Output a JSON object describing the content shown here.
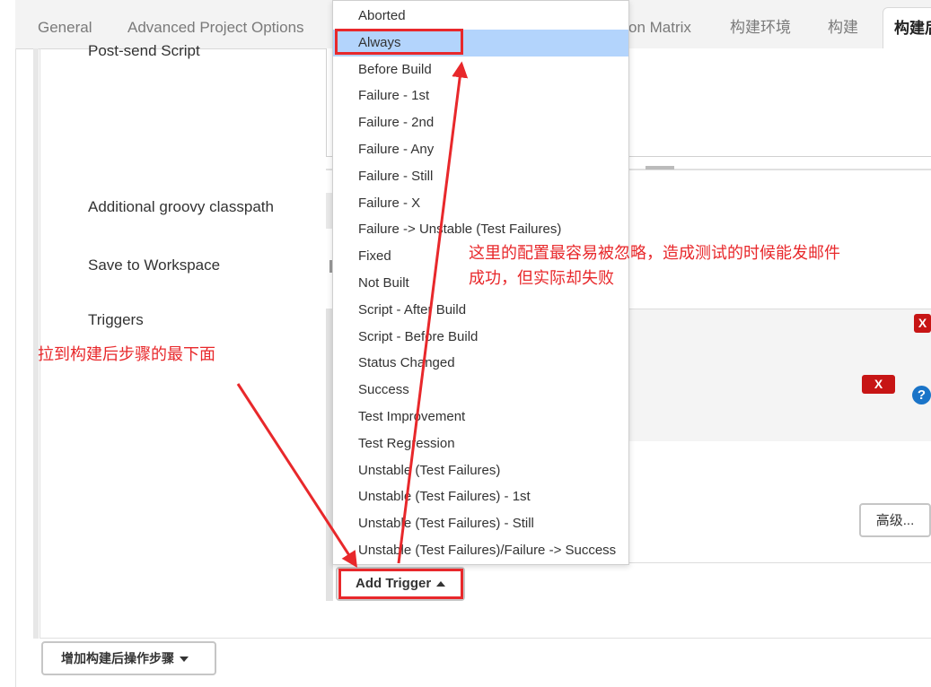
{
  "tabs": [
    {
      "label": "General"
    },
    {
      "label": "Advanced Project Options"
    },
    {
      "label": "on Matrix"
    },
    {
      "label": "构建环境"
    },
    {
      "label": "构建"
    },
    {
      "label": "构建后"
    }
  ],
  "form": {
    "post_send_script": "Post-send Script",
    "additional_groovy_classpath": "Additional groovy classpath",
    "save_to_workspace": "Save to Workspace",
    "triggers": "Triggers"
  },
  "buttons": {
    "delete": "X",
    "help": "?",
    "advanced": "高级...",
    "add_trigger": "Add Trigger",
    "add_post_build_step": "增加构建后操作步骤"
  },
  "dropdown": {
    "items": [
      {
        "label": "Aborted"
      },
      {
        "label": "Always"
      },
      {
        "label": "Before Build"
      },
      {
        "label": "Failure - 1st"
      },
      {
        "label": "Failure - 2nd"
      },
      {
        "label": "Failure - Any"
      },
      {
        "label": "Failure - Still"
      },
      {
        "label": "Failure - X"
      },
      {
        "label": "Failure -> Unstable (Test Failures)"
      },
      {
        "label": "Fixed"
      },
      {
        "label": "Not Built"
      },
      {
        "label": "Script - After Build"
      },
      {
        "label": "Script - Before Build"
      },
      {
        "label": "Status Changed"
      },
      {
        "label": "Success"
      },
      {
        "label": "Test Improvement"
      },
      {
        "label": "Test Regression"
      },
      {
        "label": "Unstable (Test Failures)"
      },
      {
        "label": "Unstable (Test Failures) - 1st"
      },
      {
        "label": "Unstable (Test Failures) - Still"
      },
      {
        "label": "Unstable (Test Failures)/Failure -> Success"
      }
    ],
    "selected": "Always"
  },
  "annotations": {
    "note_config_line1": "这里的配置最容易被忽略，造成测试的时候能发邮件",
    "note_config_line2": "成功，但实际却失败",
    "note_scroll": "拉到构建后步骤的最下面"
  },
  "colors": {
    "annotation_red": "#e8282b",
    "selected_bg": "#b3d4fc",
    "delete_red": "#c71515",
    "help_blue": "#1a74c8"
  }
}
